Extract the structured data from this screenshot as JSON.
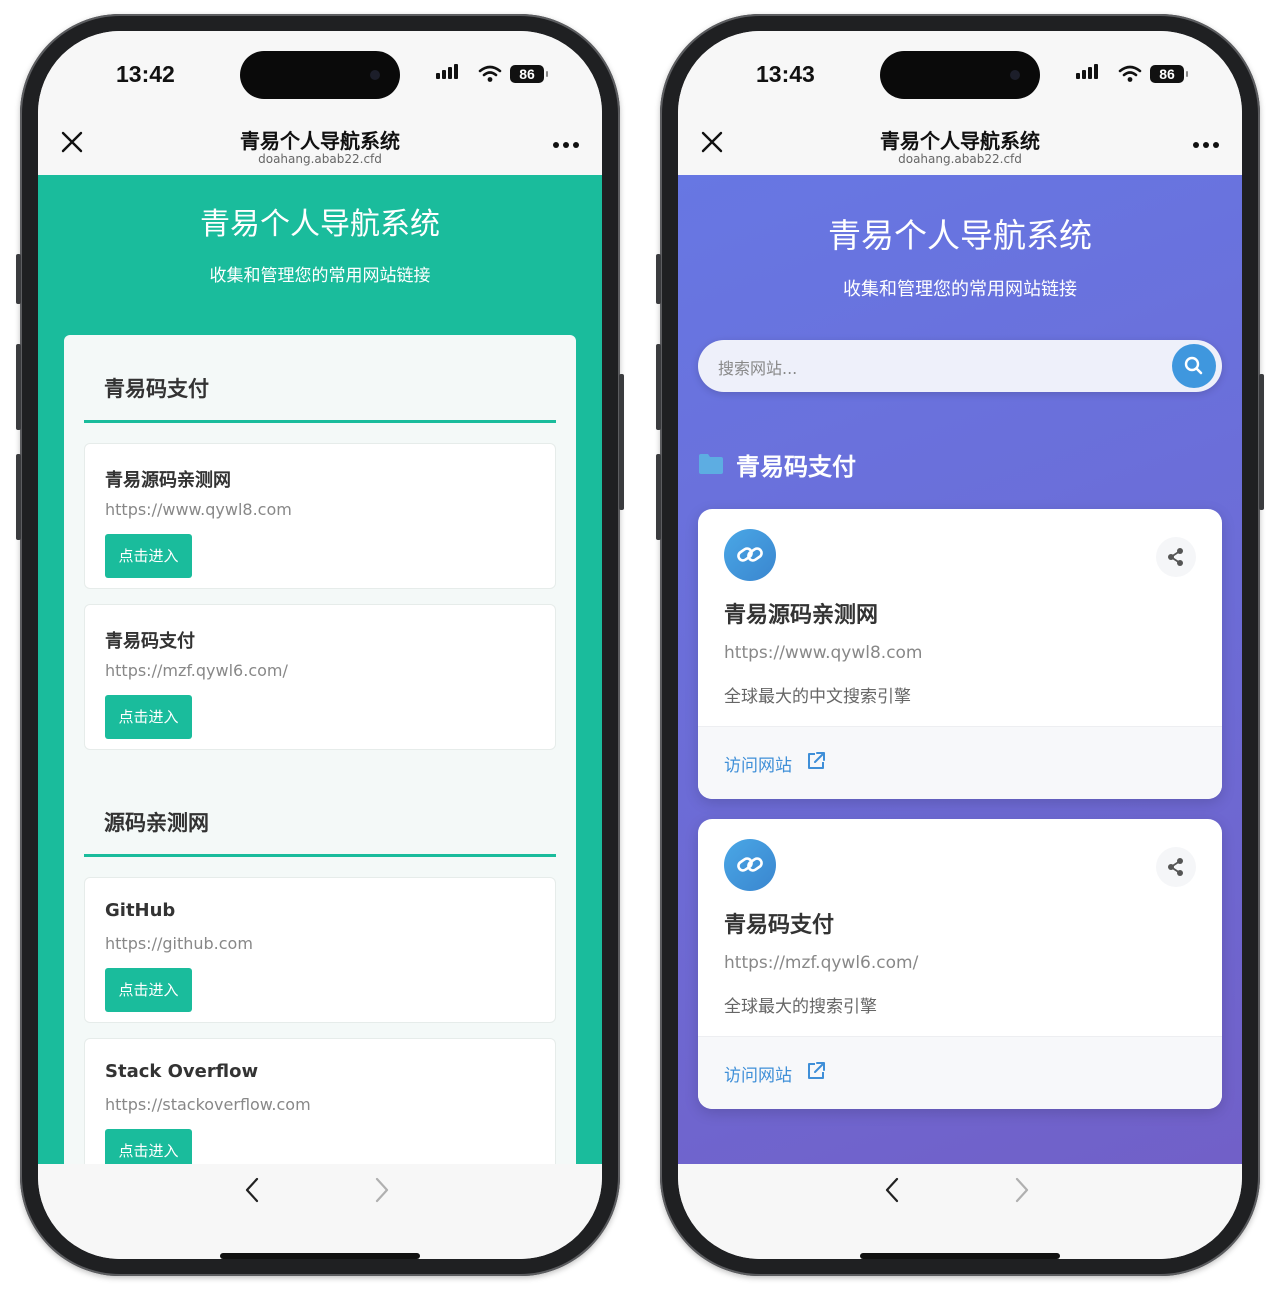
{
  "left_phone": {
    "status": {
      "time": "13:42",
      "battery": "86"
    },
    "navbar": {
      "title": "青易个人导航系统",
      "url": "doahang.abab22.cfd"
    },
    "page": {
      "title": "青易个人导航系统",
      "subtitle": "收集和管理您的常用网站链接",
      "categories": [
        {
          "name": "青易码支付",
          "sites": [
            {
              "name": "青易源码亲测网",
              "url": "https://www.qywl8.com",
              "button": "点击进入"
            },
            {
              "name": "青易码支付",
              "url": "https://mzf.qywl6.com/",
              "button": "点击进入"
            }
          ]
        },
        {
          "name": "源码亲测网",
          "sites": [
            {
              "name": "GitHub",
              "url": "https://github.com",
              "button": "点击进入"
            },
            {
              "name": "Stack Overflow",
              "url": "https://stackoverflow.com",
              "button": "点击进入"
            }
          ]
        }
      ]
    }
  },
  "right_phone": {
    "status": {
      "time": "13:43",
      "battery": "86"
    },
    "navbar": {
      "title": "青易个人导航系统",
      "url": "doahang.abab22.cfd"
    },
    "page": {
      "title": "青易个人导航系统",
      "subtitle": "收集和管理您的常用网站链接",
      "search_placeholder": "搜索网站...",
      "category": "青易码支付",
      "cards": [
        {
          "name": "青易源码亲测网",
          "url": "https://www.qywl8.com",
          "desc": "全球最大的中文搜索引擎",
          "visit": "访问网站"
        },
        {
          "name": "青易码支付",
          "url": "https://mzf.qywl6.com/",
          "desc": "全球最大的搜索引擎",
          "visit": "访问网站"
        }
      ]
    }
  },
  "icons": {
    "close": "close-icon",
    "more": "more-icon",
    "back": "back-arrow-icon",
    "forward": "forward-arrow-icon",
    "signal": "signal-icon",
    "wifi": "wifi-icon",
    "battery": "battery-icon",
    "search": "search-icon",
    "folder": "folder-icon",
    "link": "link-icon",
    "share": "share-icon",
    "external": "external-link-icon"
  },
  "colors": {
    "teal": "#1abc9c",
    "purple": "#6777e3",
    "blue_accent": "#3f97de"
  }
}
